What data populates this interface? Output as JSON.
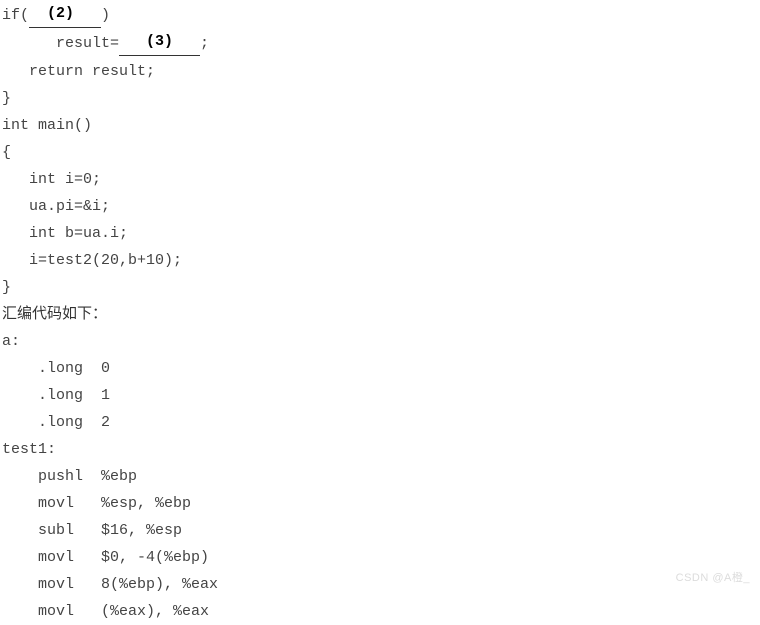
{
  "code": {
    "lines": [
      {
        "type": "if-blank",
        "prefix": "if(",
        "blank": "(2)",
        "suffix": ")"
      },
      {
        "type": "result-blank",
        "prefix": "      result=",
        "blank": "(3)",
        "suffix": ";"
      },
      {
        "type": "plain",
        "text": "   return result;"
      },
      {
        "type": "plain",
        "text": "}"
      },
      {
        "type": "plain",
        "text": "int main()"
      },
      {
        "type": "plain",
        "text": "{"
      },
      {
        "type": "plain",
        "text": "   int i=0;"
      },
      {
        "type": "plain",
        "text": "   ua.pi=&i;"
      },
      {
        "type": "plain",
        "text": "   int b=ua.i;"
      },
      {
        "type": "plain",
        "text": "   i=test2(20,b+10);"
      },
      {
        "type": "plain",
        "text": "}"
      },
      {
        "type": "chinese",
        "text": "汇编代码如下："
      },
      {
        "type": "plain",
        "text": "a:"
      },
      {
        "type": "plain",
        "text": "    .long  0"
      },
      {
        "type": "plain",
        "text": "    .long  1"
      },
      {
        "type": "plain",
        "text": "    .long  2"
      },
      {
        "type": "plain",
        "text": "test1:"
      },
      {
        "type": "plain",
        "text": "    pushl  %ebp"
      },
      {
        "type": "plain",
        "text": "    movl   %esp, %ebp"
      },
      {
        "type": "plain",
        "text": "    subl   $16, %esp"
      },
      {
        "type": "plain",
        "text": "    movl   $0, -4(%ebp)"
      },
      {
        "type": "plain",
        "text": "    movl   8(%ebp), %eax"
      },
      {
        "type": "plain",
        "text": "    movl   (%eax), %eax"
      }
    ]
  },
  "watermark": "CSDN @A橙_"
}
